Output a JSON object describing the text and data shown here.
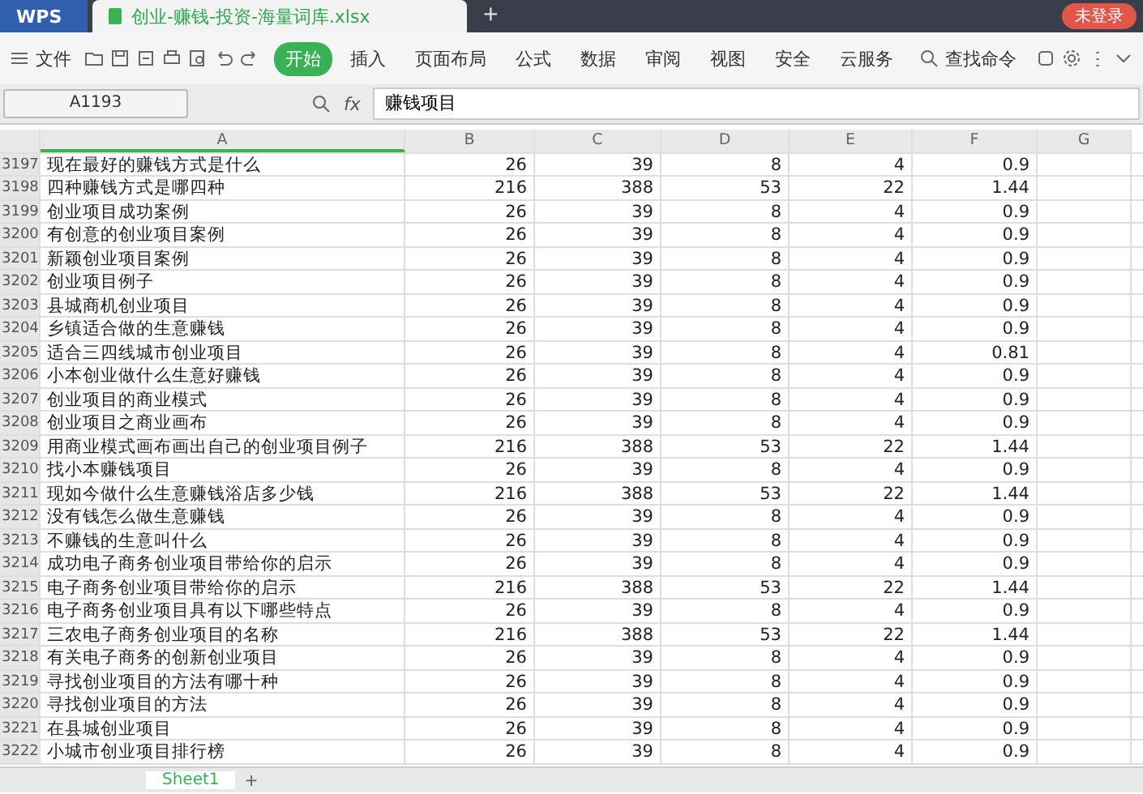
{
  "title_bar": {
    "app": "WPS",
    "file_tab": "创业-赚钱-投资-海量词库.xlsx",
    "new_tab": "+",
    "login": "未登录"
  },
  "toolbar": {
    "file_menu": "文件",
    "ribbon_tabs": [
      {
        "label": "开始",
        "selected": true
      },
      {
        "label": "插入",
        "selected": false
      },
      {
        "label": "页面布局",
        "selected": false
      },
      {
        "label": "公式",
        "selected": false
      },
      {
        "label": "数据",
        "selected": false
      },
      {
        "label": "审阅",
        "selected": false
      },
      {
        "label": "视图",
        "selected": false
      },
      {
        "label": "安全",
        "selected": false
      },
      {
        "label": "云服务",
        "selected": false
      }
    ],
    "search": "查找命令"
  },
  "formula_bar": {
    "name_box": "A1193",
    "fx": "fx",
    "value": "赚钱项目"
  },
  "table": {
    "columns": [
      "A",
      "B",
      "C",
      "D",
      "E",
      "F",
      "G"
    ],
    "rows": [
      {
        "row": "3197",
        "cells": [
          "现在最好的赚钱方式是什么",
          "26",
          "39",
          "8",
          "4",
          "0.9"
        ]
      },
      {
        "row": "3198",
        "cells": [
          "四种赚钱方式是哪四种",
          "216",
          "388",
          "53",
          "22",
          "1.44"
        ]
      },
      {
        "row": "3199",
        "cells": [
          "创业项目成功案例",
          "26",
          "39",
          "8",
          "4",
          "0.9"
        ]
      },
      {
        "row": "3200",
        "cells": [
          "有创意的创业项目案例",
          "26",
          "39",
          "8",
          "4",
          "0.9"
        ]
      },
      {
        "row": "3201",
        "cells": [
          "新颖创业项目案例",
          "26",
          "39",
          "8",
          "4",
          "0.9"
        ]
      },
      {
        "row": "3202",
        "cells": [
          "创业项目例子",
          "26",
          "39",
          "8",
          "4",
          "0.9"
        ]
      },
      {
        "row": "3203",
        "cells": [
          "县城商机创业项目",
          "26",
          "39",
          "8",
          "4",
          "0.9"
        ]
      },
      {
        "row": "3204",
        "cells": [
          "乡镇适合做的生意赚钱",
          "26",
          "39",
          "8",
          "4",
          "0.9"
        ]
      },
      {
        "row": "3205",
        "cells": [
          "适合三四线城市创业项目",
          "26",
          "39",
          "8",
          "4",
          "0.81"
        ]
      },
      {
        "row": "3206",
        "cells": [
          "小本创业做什么生意好赚钱",
          "26",
          "39",
          "8",
          "4",
          "0.9"
        ]
      },
      {
        "row": "3207",
        "cells": [
          "创业项目的商业模式",
          "26",
          "39",
          "8",
          "4",
          "0.9"
        ]
      },
      {
        "row": "3208",
        "cells": [
          "创业项目之商业画布",
          "26",
          "39",
          "8",
          "4",
          "0.9"
        ]
      },
      {
        "row": "3209",
        "cells": [
          "用商业模式画布画出自己的创业项目例子",
          "216",
          "388",
          "53",
          "22",
          "1.44"
        ]
      },
      {
        "row": "3210",
        "cells": [
          "找小本赚钱项目",
          "26",
          "39",
          "8",
          "4",
          "0.9"
        ]
      },
      {
        "row": "3211",
        "cells": [
          "现如今做什么生意赚钱浴店多少钱",
          "216",
          "388",
          "53",
          "22",
          "1.44"
        ]
      },
      {
        "row": "3212",
        "cells": [
          "没有钱怎么做生意赚钱",
          "26",
          "39",
          "8",
          "4",
          "0.9"
        ]
      },
      {
        "row": "3213",
        "cells": [
          "不赚钱的生意叫什么",
          "26",
          "39",
          "8",
          "4",
          "0.9"
        ]
      },
      {
        "row": "3214",
        "cells": [
          "成功电子商务创业项目带给你的启示",
          "26",
          "39",
          "8",
          "4",
          "0.9"
        ]
      },
      {
        "row": "3215",
        "cells": [
          "电子商务创业项目带给你的启示",
          "216",
          "388",
          "53",
          "22",
          "1.44"
        ]
      },
      {
        "row": "3216",
        "cells": [
          "电子商务创业项目具有以下哪些特点",
          "26",
          "39",
          "8",
          "4",
          "0.9"
        ]
      },
      {
        "row": "3217",
        "cells": [
          "三农电子商务创业项目的名称",
          "216",
          "388",
          "53",
          "22",
          "1.44"
        ]
      },
      {
        "row": "3218",
        "cells": [
          "有关电子商务的创新创业项目",
          "26",
          "39",
          "8",
          "4",
          "0.9"
        ]
      },
      {
        "row": "3219",
        "cells": [
          "寻找创业项目的方法有哪十种",
          "26",
          "39",
          "8",
          "4",
          "0.9"
        ]
      },
      {
        "row": "3220",
        "cells": [
          "寻找创业项目的方法",
          "26",
          "39",
          "8",
          "4",
          "0.9"
        ]
      },
      {
        "row": "3221",
        "cells": [
          "在县城创业项目",
          "26",
          "39",
          "8",
          "4",
          "0.9"
        ]
      },
      {
        "row": "3222",
        "cells": [
          "小城市创业项目排行榜",
          "26",
          "39",
          "8",
          "4",
          "0.9"
        ]
      }
    ]
  },
  "sheet_tabs": [
    {
      "label": "Sheet1",
      "selected": true
    }
  ],
  "add_sheet": "+"
}
